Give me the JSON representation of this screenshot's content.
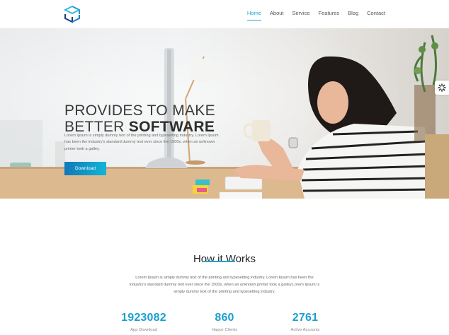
{
  "nav": {
    "items": [
      {
        "label": "Home",
        "active": true
      },
      {
        "label": "About",
        "active": false
      },
      {
        "label": "Service",
        "active": false
      },
      {
        "label": "Features",
        "active": false
      },
      {
        "label": "Blog",
        "active": false
      },
      {
        "label": "Contact",
        "active": false
      }
    ]
  },
  "hero": {
    "title_line1": "PROVIDES TO MAKE",
    "title_line2_plain": "BETTER ",
    "title_line2_bold": "SOFTWARE",
    "description": "Lorem Ipsum is simply dummy text of the printing and typesetting industry. Lorem Ipsum has been the industry's standard dummy text ever since the 1500s, when an unknown printer took a galley.",
    "button_label": "Download"
  },
  "how_it_works": {
    "title": "How it Works",
    "description": "Lorem Ipsum is simply dummy text of the printing and typesetting industry. Lorem Ipsum has been the industry's standard dummy text ever since the 1500s, when an unknown printer took a galley.Lorem Ipsum is simply dummy text of the printing and typesetting industry."
  },
  "stats": [
    {
      "value": "1923082",
      "label": "App Download"
    },
    {
      "value": "860",
      "label": "Happy Clients"
    },
    {
      "value": "2761",
      "label": "Active Accounts"
    }
  ],
  "colors": {
    "accent": "#13a9d1",
    "button_start": "#1178b8",
    "button_end": "#12b5d6",
    "stat_number": "#1b9fcf"
  },
  "icons": {
    "logo": "cube-logo-icon",
    "side_widget": "gear-icon"
  }
}
